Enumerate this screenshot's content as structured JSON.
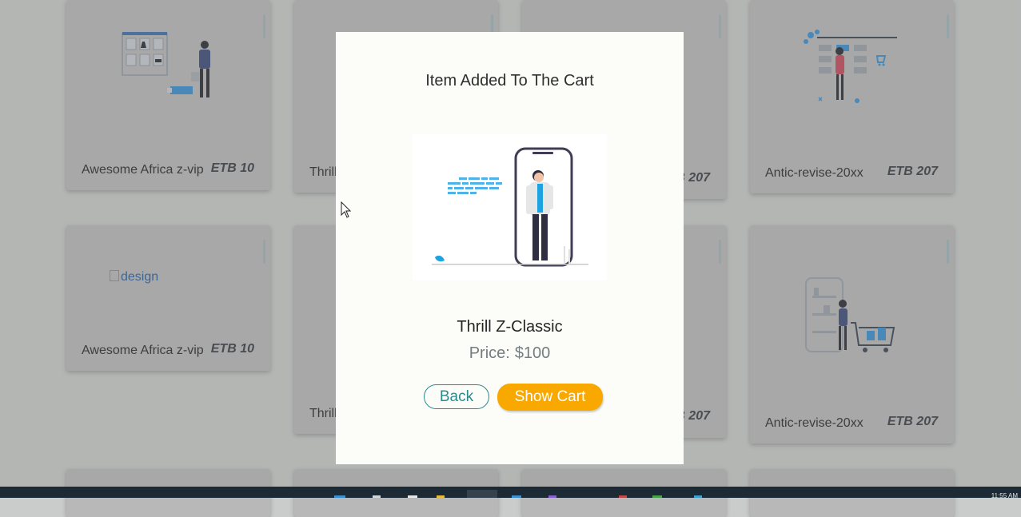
{
  "modal": {
    "title": "Item Added To The Cart",
    "product_name": "Thrill Z-Classic",
    "price_label": "Price:",
    "price_value": "$100",
    "back_label": "Back",
    "show_cart_label": "Show Cart",
    "image_icon": "phone-person-illustration"
  },
  "cards": [
    {
      "name": "Awesome Africa z-vip",
      "price": "ETB 10",
      "illustration": "closet-shopping-illustration"
    },
    {
      "name": "Thrill",
      "price": "",
      "illustration": ""
    },
    {
      "name": "",
      "price": "B 207",
      "illustration": ""
    },
    {
      "name": "Antic-revise-20xx",
      "price": "ETB 207",
      "illustration": "store-window-illustration"
    },
    {
      "name": "Awesome Africa z-vip",
      "price": "ETB 10",
      "broken_image_alt": "design"
    },
    {
      "name": "Thrill",
      "price": "",
      "illustration": ""
    },
    {
      "name": "",
      "price": "B 207",
      "illustration": ""
    },
    {
      "name": "Antic-revise-20xx",
      "price": "ETB 207",
      "illustration": "shopping-cart-illustration"
    }
  ],
  "colors": {
    "accent_orange": "#f9a800",
    "accent_teal": "#2a8a8e",
    "modal_bg": "#fcfdf8",
    "taskbar_bg": "#1b2a34"
  },
  "taskbar": {
    "tray_text": "11:55 AM"
  }
}
